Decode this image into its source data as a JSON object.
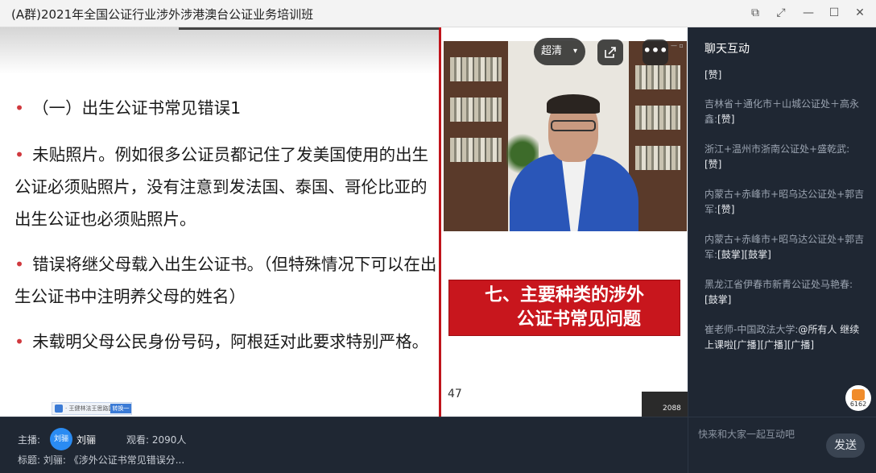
{
  "window": {
    "title": "(A群)2021年全国公证行业涉外涉港澳台公证业务培训班",
    "buttons": {
      "pip": "⧉",
      "expand": "⤢",
      "minimize": "—",
      "maximize": "☐",
      "close": "✕"
    }
  },
  "slide": {
    "bullets": [
      {
        "text": "（一）出生公证书常见错误1"
      },
      {
        "text": "未贴照片。例如很多公证员都记住了发美国使用的出生公证必须贴照片，没有注意到发法国、泰国、哥伦比亚的出生公证也必须贴照片。"
      },
      {
        "text": "错误将继父母载入出生公证书。（但特殊情况下可以在出生公证书中注明养父母的姓名）"
      },
      {
        "text": "未载明父母公民身份号码，阿根廷对此要求特别严格。"
      }
    ],
    "bullet_marker": "•",
    "mini_toolbar": {
      "label": "· 王健林法王思路国际",
      "button": "转换一下"
    },
    "red_box": {
      "line1": "七、主要种类的涉外",
      "line2": "公证书常见问题"
    },
    "page_number": "47",
    "thumb_count": "2088"
  },
  "video": {
    "quality_label": "超清",
    "caret": "▾",
    "more_label": "•••",
    "tiny_controls": "— ▫"
  },
  "chat": {
    "title": "聊天互动",
    "messages": [
      {
        "sender": "",
        "text": "[赞]"
      },
      {
        "sender": "吉林省＋通化市＋山城公证处＋高永鑫:",
        "text": "[赞]"
      },
      {
        "sender": "浙江+温州市浙南公证处+盛乾武:",
        "text": "[赞]"
      },
      {
        "sender": "内蒙古+赤峰市+昭乌达公证处+郭吉军:",
        "text": "[赞]"
      },
      {
        "sender": "内蒙古+赤峰市+昭乌达公证处+郭吉军:",
        "text": "[鼓掌][鼓掌]"
      },
      {
        "sender": "黑龙江省伊春市新青公证处马艳春:",
        "text": "[鼓掌]"
      },
      {
        "sender": "崔老师-中国政法大学:",
        "text": "@所有人 继续上课啦[广播][广播][广播]"
      }
    ],
    "like_count": "6162",
    "input_placeholder": "快来和大家一起互动吧",
    "send_label": "发送"
  },
  "footer": {
    "host_label": "主播:",
    "host_avatar_text": "刘骊",
    "host_name": "刘骊",
    "viewers_label": "观看: 2090人",
    "title_label": "标题: 刘骊: 《涉外公证书常见错误分..."
  }
}
